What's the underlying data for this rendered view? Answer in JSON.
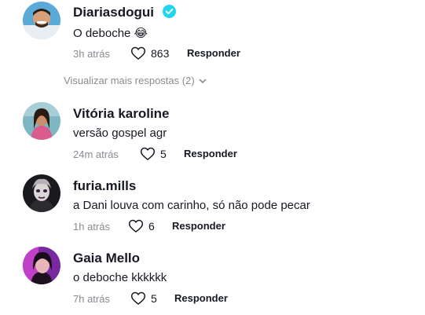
{
  "comments": [
    {
      "username": "Diariasdogui",
      "verified": true,
      "text": "O deboche 😂",
      "time": "3h atrás",
      "likes": "863",
      "reply_label": "Responder"
    },
    {
      "username": "Vitória karoline",
      "verified": false,
      "text": "versão gospel agr",
      "time": "24m atrás",
      "likes": "5",
      "reply_label": "Responder"
    },
    {
      "username": "furia.mills",
      "verified": false,
      "text": "a Dani louva com carinho, só não pode pecar",
      "time": "1h atrás",
      "likes": "6",
      "reply_label": "Responder"
    },
    {
      "username": "Gaia Mello",
      "verified": false,
      "text": "o deboche kkkkkk",
      "time": "7h atrás",
      "likes": "5",
      "reply_label": "Responder"
    }
  ],
  "view_more_replies": "Visualizar mais respostas (2)",
  "colors": {
    "verified_badge": "#20d5ec",
    "secondary_text": "#8a8b91"
  },
  "icons": {
    "like": "heart-outline-icon",
    "verified": "verified-check-icon",
    "expand": "chevron-down-icon"
  }
}
